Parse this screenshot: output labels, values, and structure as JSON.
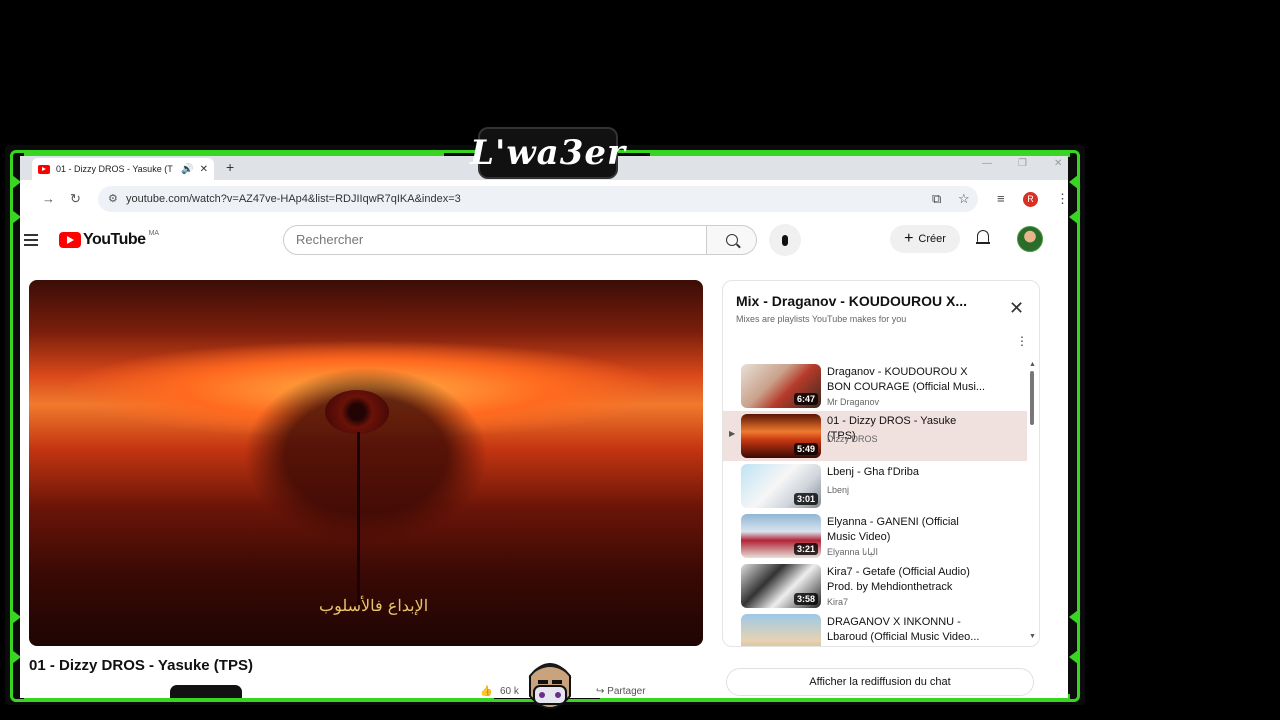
{
  "overlay": {
    "brand_text": "L'wa3er"
  },
  "tab": {
    "title": "01 - Dizzy DROS - Yasuke (T",
    "audio_icon": "speaker-icon",
    "close": "✕",
    "new_tab": "+"
  },
  "address": {
    "url": "youtube.com/watch?v=AZ47ve-HAp4&list=RDJIIqwR7qIKA&index=3",
    "profile_initial": "R"
  },
  "youtube": {
    "logo_text": "YouTube",
    "country": "MA",
    "search_placeholder": "Rechercher",
    "create_label": "Créer"
  },
  "video": {
    "title": "01 - Dizzy DROS - Yasuke (TPS)",
    "overlay_text": "الإبداع فالأسلوب"
  },
  "playlist": {
    "title": "Mix - Draganov - KOUDOUROU X...",
    "subtitle": "Mixes are playlists YouTube makes for you",
    "items": [
      {
        "title": "Draganov - KOUDOUROU X BON COURAGE (Official Musi...",
        "channel": "Mr Draganov",
        "duration": "6:47",
        "active": false
      },
      {
        "title": "01 - Dizzy DROS - Yasuke (TPS)",
        "channel": "Dizzy DROS",
        "duration": "5:49",
        "active": true
      },
      {
        "title": "Lbenj - Gha f'Driba",
        "channel": "Lbenj",
        "duration": "3:01",
        "active": false
      },
      {
        "title": "Elyanna - GANENI (Official Music Video)",
        "channel": "Elyanna اليانا",
        "duration": "3:21",
        "active": false
      },
      {
        "title": "Kira7 - Getafe (Official Audio) Prod. by Mehdionthetrack",
        "channel": "Kira7",
        "duration": "3:58",
        "active": false
      },
      {
        "title": "DRAGANOV X INKONNU - Lbaroud (Official Music Video...",
        "channel": "",
        "duration": "",
        "active": false
      }
    ]
  },
  "chat_replay": {
    "label": "Afficher la rediffusion du chat"
  },
  "actions": {
    "share_label": "Partager",
    "likes": "60 k"
  },
  "colors": {
    "frame_green": "#39d523",
    "youtube_red": "#ff0000",
    "active_row": "#f0e0de"
  }
}
